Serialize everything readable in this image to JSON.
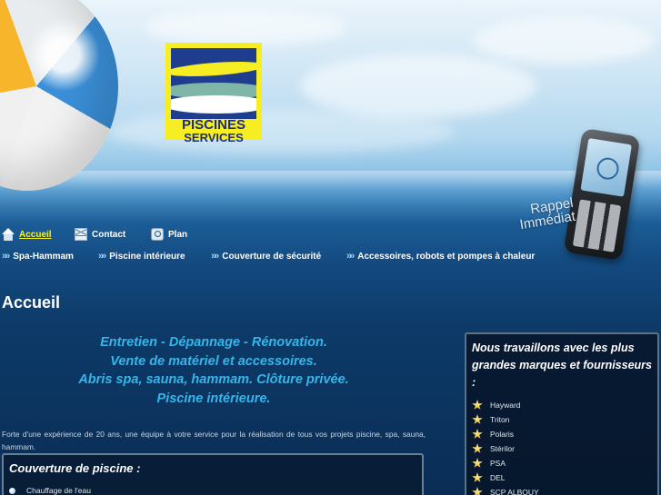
{
  "header": {
    "logo_line1": "PISCINES",
    "logo_line2": "SERVICES",
    "callback_line1": "Rappel",
    "callback_line2": "Immédiat"
  },
  "nav_primary": [
    {
      "label": "Accueil",
      "icon": "home-icon",
      "active": true
    },
    {
      "label": "Contact",
      "icon": "mail-icon"
    },
    {
      "label": "Plan",
      "icon": "sitemap-icon"
    }
  ],
  "nav_secondary": [
    {
      "label": "Spa-Hammam"
    },
    {
      "label": "Piscine intérieure"
    },
    {
      "label": "Couverture de sécurité"
    },
    {
      "label": "Accessoires, robots et pompes à chaleur"
    }
  ],
  "main": {
    "title": "Accueil",
    "tagline": [
      "Entretien - Dépannage - Rénovation.",
      "Vente de matériel et accessoires.",
      "Abris spa, sauna, hammam. Clôture privée.",
      "Piscine intérieure."
    ],
    "intro": "Forte d'une expérience de 20 ans, une équipe à votre service pour la réalisation de tous vos projets piscine, spa, sauna, hammam."
  },
  "box_left": {
    "title": "Couverture de piscine :",
    "items": [
      "Chauffage de l'eau"
    ]
  },
  "box_right": {
    "title": "Nous travaillons avec les plus grandes marques et fournisseurs :",
    "brands": [
      "Hayward",
      "Triton",
      "Polaris",
      "Stérilor",
      "PSA",
      "DEL",
      "SCP ALBOUY"
    ]
  },
  "colors": {
    "accent_yellow": "#f7f22a",
    "tagline_blue": "#35b6ea",
    "logo_blue": "#1e3d8f"
  }
}
